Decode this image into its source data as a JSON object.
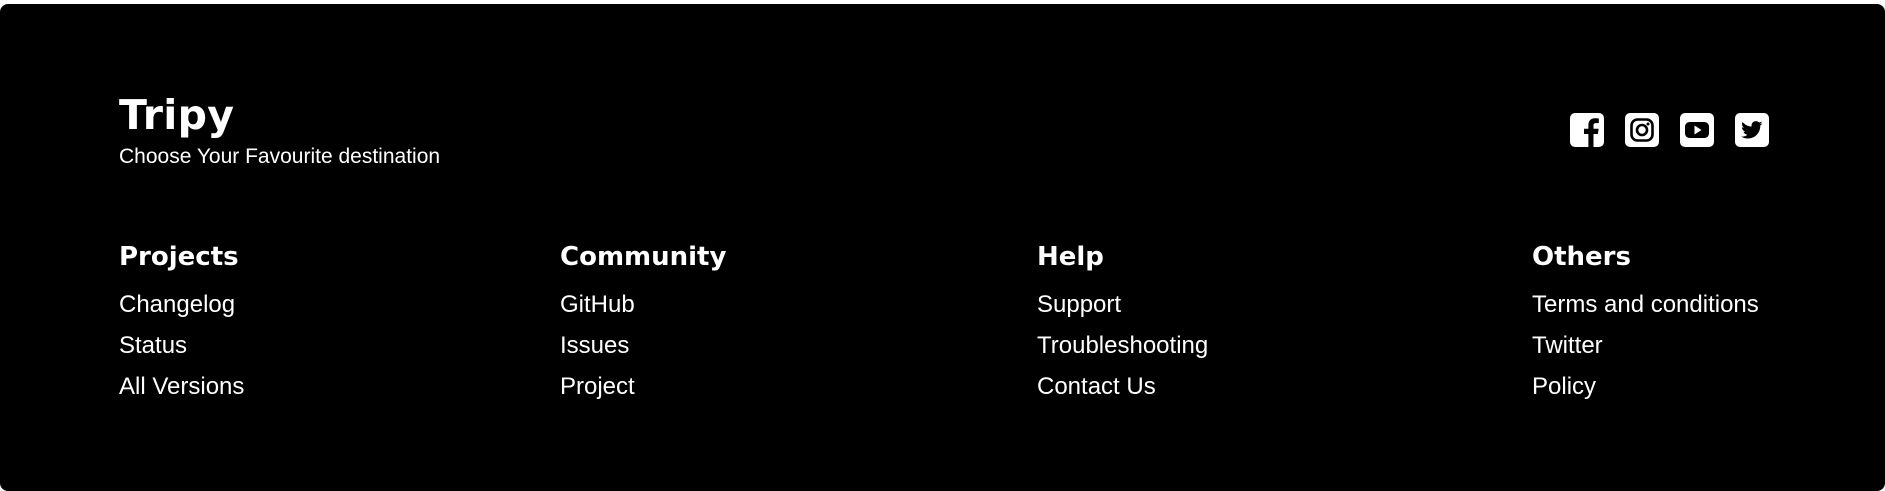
{
  "brand": {
    "title": "Tripy",
    "tagline": "Choose Your Favourite destination"
  },
  "social": {
    "icons": [
      "facebook-icon",
      "instagram-icon",
      "youtube-icon",
      "twitter-icon"
    ]
  },
  "columns": [
    {
      "title": "Projects",
      "links": [
        "Changelog",
        "Status",
        "All Versions"
      ]
    },
    {
      "title": "Community",
      "links": [
        "GitHub",
        "Issues",
        "Project"
      ]
    },
    {
      "title": "Help",
      "links": [
        "Support",
        "Troubleshooting",
        "Contact Us"
      ]
    },
    {
      "title": "Others",
      "links": [
        "Terms and conditions",
        "Twitter",
        "Policy"
      ]
    }
  ],
  "colors": {
    "background": "#000000",
    "text": "#ffffff",
    "page": "#ffffff"
  }
}
